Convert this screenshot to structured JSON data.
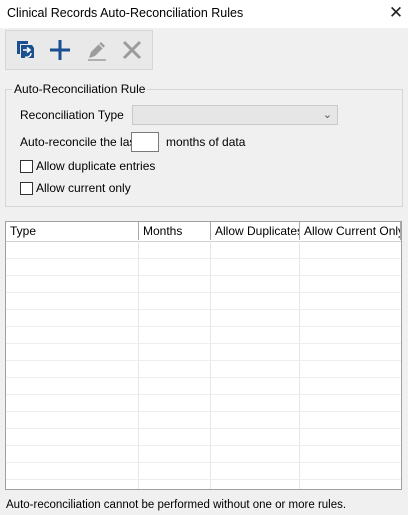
{
  "window": {
    "title": "Clinical Records Auto-Reconciliation Rules",
    "close_symbol": "✕"
  },
  "toolbar": {
    "buttons": [
      {
        "name": "import-rules-icon",
        "enabled": true
      },
      {
        "name": "add-icon",
        "enabled": true
      },
      {
        "name": "edit-icon",
        "enabled": false
      },
      {
        "name": "delete-icon",
        "enabled": false
      }
    ]
  },
  "rule": {
    "group_title": "Auto-Reconciliation Rule",
    "type_label": "Reconciliation Type",
    "type_value": "",
    "auto_label": "Auto-reconcile the last",
    "months_value": "",
    "months_suffix": "months of data",
    "allow_duplicates_label": "Allow duplicate entries",
    "allow_duplicates_checked": false,
    "allow_current_label": "Allow current only",
    "allow_current_checked": false
  },
  "table": {
    "columns": [
      "Type",
      "Months",
      "Allow Duplicates",
      "Allow Current Only"
    ],
    "rows": []
  },
  "status": "Auto-reconciliation cannot be performed without one or more rules.",
  "colors": {
    "accent": "#1c4f8f",
    "disabled": "#9c9c9c",
    "window_bg": "#f0f0f0"
  }
}
